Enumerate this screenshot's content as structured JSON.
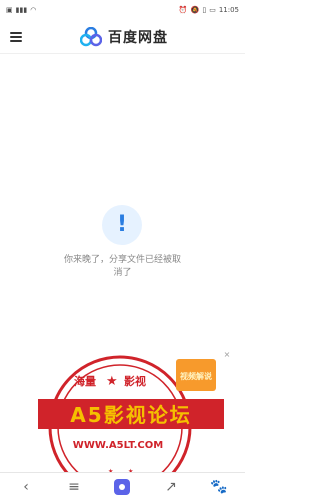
{
  "status_bar": {
    "time": "11:05",
    "left_icons": [
      "sim-icon",
      "signal-icon",
      "wifi-icon"
    ],
    "right_icons": [
      "alarm-icon",
      "mute-icon",
      "vibrate-icon",
      "battery-icon"
    ]
  },
  "header": {
    "app_name": "百度网盘"
  },
  "notice": {
    "icon_text": "!",
    "message": "你来晚了，分享文件已经被取消了"
  },
  "watermark": {
    "left_text": "海量",
    "right_text": "影视",
    "main_text": "A5影视论坛",
    "url": "WWW.A5LT.COM",
    "ad_badge": "视频解说",
    "close": "×"
  },
  "bottom_nav": {
    "items": [
      "back-icon",
      "menu-icon",
      "baidu-app-icon",
      "share-icon",
      "paw-icon"
    ]
  },
  "colors": {
    "brand_blue": "#2a7de1",
    "stamp_red": "#d0232a",
    "stamp_gold": "#f5c000"
  }
}
